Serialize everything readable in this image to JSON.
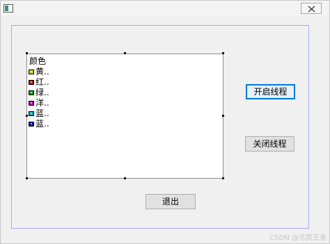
{
  "window": {
    "close_symbol": "✕"
  },
  "list": {
    "header": "颜色",
    "items": [
      {
        "label": "黄..",
        "color": "#c8c800"
      },
      {
        "label": "红..",
        "color": "#c00000"
      },
      {
        "label": "绿..",
        "color": "#00a000"
      },
      {
        "label": "洋..",
        "color": "#b000b0"
      },
      {
        "label": "蓝..",
        "color": "#00a8a8"
      },
      {
        "label": "蓝..",
        "color": "#0000b0"
      }
    ]
  },
  "buttons": {
    "start_thread": "开启线程",
    "stop_thread": "关闭线程",
    "exit": "退出"
  },
  "watermark": "CSDN @北冥王者"
}
